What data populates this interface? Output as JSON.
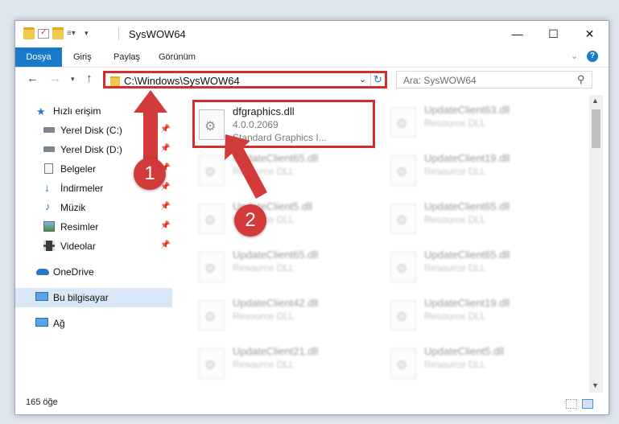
{
  "window": {
    "title": "SysWOW64",
    "controls": {
      "minimize": "—",
      "maximize": "☐",
      "close": "✕"
    }
  },
  "ribbon": {
    "tabs": [
      "Dosya",
      "Giriş",
      "Paylaş",
      "Görünüm"
    ],
    "help": "?"
  },
  "navigation": {
    "address": "C:\\Windows\\SysWOW64",
    "search_placeholder": "Ara: SysWOW64"
  },
  "sidebar": {
    "items": [
      {
        "label": "Hızlı erişim",
        "icon": "star-icon",
        "pinned": false
      },
      {
        "label": "Yerel Disk (C:)",
        "icon": "drive-icon",
        "pinned": true
      },
      {
        "label": "Yerel Disk (D:)",
        "icon": "drive-icon",
        "pinned": true
      },
      {
        "label": "Belgeler",
        "icon": "documents-icon",
        "pinned": true
      },
      {
        "label": "İndirmeler",
        "icon": "downloads-icon",
        "pinned": true
      },
      {
        "label": "Müzik",
        "icon": "music-icon",
        "pinned": true
      },
      {
        "label": "Resimler",
        "icon": "pictures-icon",
        "pinned": true
      },
      {
        "label": "Videolar",
        "icon": "videos-icon",
        "pinned": true
      },
      {
        "label": "OneDrive",
        "icon": "onedrive-icon",
        "pinned": false
      },
      {
        "label": "Bu bilgisayar",
        "icon": "computer-icon",
        "pinned": false
      },
      {
        "label": "Ağ",
        "icon": "network-icon",
        "pinned": false
      }
    ]
  },
  "files": {
    "highlighted": {
      "name": "dfgraphics.dll",
      "version": "4.0.0.2069",
      "description": "Standard Graphics I..."
    },
    "left_column": [
      {
        "name": "UpdateClient65.dll",
        "type": "Resource DLL"
      },
      {
        "name": "UpdateClient5.dll",
        "type": "Resource DLL"
      },
      {
        "name": "UpdateClient65.dll",
        "type": "Resource DLL"
      },
      {
        "name": "UpdateClient42.dll",
        "type": "Resource DLL"
      },
      {
        "name": "UpdateClient21.dll",
        "type": "Resource DLL"
      }
    ],
    "right_column": [
      {
        "name": "UpdateClient63.dll",
        "type": "Resource DLL"
      },
      {
        "name": "UpdateClient19.dll",
        "type": "Resource DLL"
      },
      {
        "name": "UpdateClient65.dll",
        "type": "Resource DLL"
      },
      {
        "name": "UpdateClient65.dll",
        "type": "Resource DLL"
      },
      {
        "name": "UpdateClient19.dll",
        "type": "Resource DLL"
      },
      {
        "name": "UpdateClient5.dll",
        "type": "Resource DLL"
      }
    ]
  },
  "status": {
    "item_count": "165 öğe"
  },
  "annotations": {
    "step1": "1",
    "step2": "2",
    "color": "#d33a3a"
  }
}
